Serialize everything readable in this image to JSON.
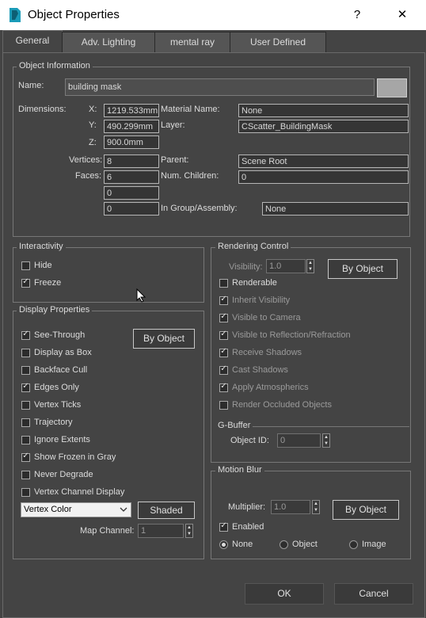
{
  "window": {
    "title": "Object Properties",
    "help": "?",
    "close": "✕"
  },
  "tabs": [
    {
      "label": "General"
    },
    {
      "label": "Adv. Lighting"
    },
    {
      "label": "mental ray"
    },
    {
      "label": "User Defined"
    }
  ],
  "object_info": {
    "title": "Object Information",
    "name_label": "Name:",
    "name_value": "building mask",
    "color_swatch": "#a6a6a6",
    "dimensions_label": "Dimensions:",
    "x_label": "X:",
    "x_value": "1219.533mm",
    "y_label": "Y:",
    "y_value": "490.299mm",
    "z_label": "Z:",
    "z_value": "900.0mm",
    "vertices_label": "Vertices:",
    "vertices_value": "8",
    "faces_label": "Faces:",
    "faces_value": "6",
    "extra1_value": "0",
    "extra2_value": "0",
    "material_label": "Material Name:",
    "material_value": "None",
    "layer_label": "Layer:",
    "layer_value": "CScatter_BuildingMask",
    "parent_label": "Parent:",
    "parent_value": "Scene Root",
    "children_label": "Num. Children:",
    "children_value": "0",
    "group_label": "In Group/Assembly:",
    "group_value": "None"
  },
  "interactivity": {
    "title": "Interactivity",
    "hide": {
      "label": "Hide",
      "checked": false
    },
    "freeze": {
      "label": "Freeze",
      "checked": true
    }
  },
  "display": {
    "title": "Display Properties",
    "by_object": "By Object",
    "items": [
      {
        "label": "See-Through",
        "checked": true
      },
      {
        "label": "Display as Box",
        "checked": false
      },
      {
        "label": "Backface Cull",
        "checked": false
      },
      {
        "label": "Edges Only",
        "checked": true
      },
      {
        "label": "Vertex Ticks",
        "checked": false
      },
      {
        "label": "Trajectory",
        "checked": false
      },
      {
        "label": "Ignore Extents",
        "checked": false
      },
      {
        "label": "Show Frozen in Gray",
        "checked": true
      },
      {
        "label": "Never Degrade",
        "checked": false
      },
      {
        "label": "Vertex Channel Display",
        "checked": false
      }
    ],
    "vertex_color_select": "Vertex Color",
    "shaded": "Shaded",
    "map_channel_label": "Map Channel:",
    "map_channel_value": "1"
  },
  "rendering": {
    "title": "Rendering Control",
    "visibility_label": "Visibility:",
    "visibility_value": "1.0",
    "by_object": "By Object",
    "items": [
      {
        "label": "Renderable",
        "checked": false
      },
      {
        "label": "Inherit Visibility",
        "checked": true
      },
      {
        "label": "Visible to Camera",
        "checked": true
      },
      {
        "label": "Visible to Reflection/Refraction",
        "checked": true
      },
      {
        "label": "Receive Shadows",
        "checked": true
      },
      {
        "label": "Cast Shadows",
        "checked": true
      },
      {
        "label": "Apply Atmospherics",
        "checked": true
      },
      {
        "label": "Render Occluded Objects",
        "checked": false
      }
    ]
  },
  "gbuffer": {
    "title": "G-Buffer",
    "object_id_label": "Object ID:",
    "object_id_value": "0"
  },
  "motion_blur": {
    "title": "Motion Blur",
    "multiplier_label": "Multiplier:",
    "multiplier_value": "1.0",
    "by_object": "By Object",
    "enabled_label": "Enabled",
    "enabled_checked": true,
    "radio_none": "None",
    "radio_object": "Object",
    "radio_image": "Image"
  },
  "footer": {
    "ok": "OK",
    "cancel": "Cancel"
  }
}
